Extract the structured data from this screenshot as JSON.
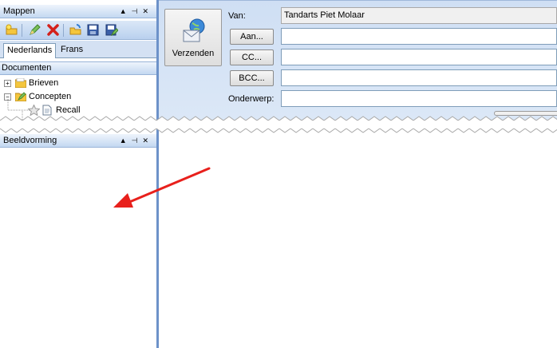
{
  "left": {
    "mappen_panel": {
      "title": "Mappen"
    },
    "tabs": [
      {
        "label": "Nederlands",
        "active": true
      },
      {
        "label": "Frans",
        "active": false
      }
    ],
    "tree_header": "Documenten",
    "tree_items": [
      {
        "label": "Brieven",
        "expander": "+",
        "icon": "folder-icon"
      },
      {
        "label": "Concepten",
        "expander": "−",
        "icon": "folder-edit-icon"
      },
      {
        "label": "Recall",
        "icon": "document-icon"
      }
    ],
    "beeldvorming_panel": {
      "title": "Beeldvorming"
    }
  },
  "compose": {
    "send_label": "Verzenden",
    "van_label": "Van:",
    "van_value": "Tandarts Piet Molaar",
    "aan_label": "Aan...",
    "cc_label": "CC...",
    "bcc_label": "BCC...",
    "onderwerp_label": "Onderwerp:",
    "aan_value": "",
    "cc_value": "",
    "bcc_value": "",
    "onderwerp_value": ""
  },
  "colors": {
    "accent": "#6d92c9",
    "annotation_arrow": "#e8201c"
  }
}
